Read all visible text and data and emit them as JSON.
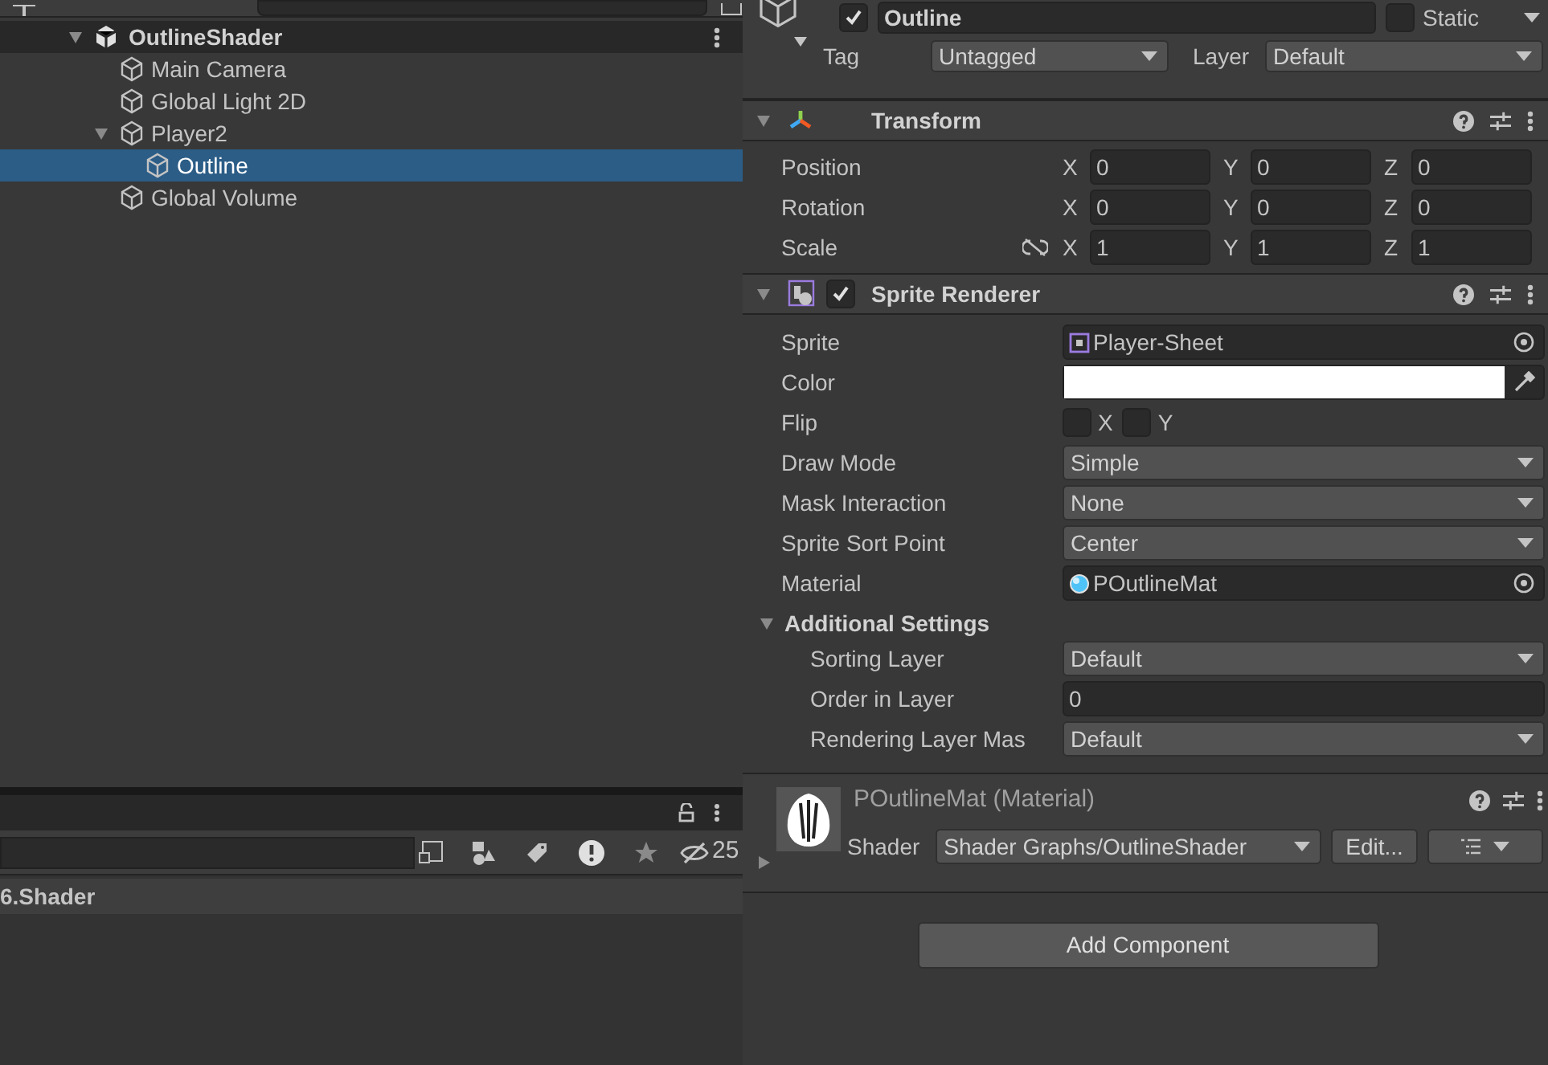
{
  "hierarchy": {
    "scene": {
      "name": "OutlineShader",
      "expanded": true
    },
    "items": [
      {
        "name": "Main Camera",
        "selected": false
      },
      {
        "name": "Global Light 2D",
        "selected": false
      },
      {
        "name": "Player2",
        "selected": false,
        "expanded": true,
        "children": [
          {
            "name": "Outline",
            "selected": true
          }
        ]
      },
      {
        "name": "Global Volume",
        "selected": false
      }
    ]
  },
  "project": {
    "hidden_count": "25",
    "rows": [
      {
        "label": "6.Shader"
      }
    ]
  },
  "inspector": {
    "object": {
      "name": "Outline",
      "active": true,
      "static_label": "Static",
      "static": false,
      "tag_label": "Tag",
      "tag": "Untagged",
      "layer_label": "Layer",
      "layer": "Default"
    },
    "transform": {
      "title": "Transform",
      "expanded": true,
      "rows": [
        {
          "label": "Position",
          "linked": false,
          "axes": [
            {
              "label": "X",
              "value": "0"
            },
            {
              "label": "Y",
              "value": "0"
            },
            {
              "label": "Z",
              "value": "0"
            }
          ]
        },
        {
          "label": "Rotation",
          "linked": false,
          "axes": [
            {
              "label": "X",
              "value": "0"
            },
            {
              "label": "Y",
              "value": "0"
            },
            {
              "label": "Z",
              "value": "0"
            }
          ]
        },
        {
          "label": "Scale",
          "linked": true,
          "axes": [
            {
              "label": "X",
              "value": "1"
            },
            {
              "label": "Y",
              "value": "1"
            },
            {
              "label": "Z",
              "value": "1"
            }
          ]
        }
      ]
    },
    "sprite_renderer": {
      "title": "Sprite Renderer",
      "enabled": true,
      "expanded": true,
      "fields": [
        {
          "kind": "sprite_ref",
          "label": "Sprite",
          "value": "Player-Sheet"
        },
        {
          "kind": "color",
          "label": "Color",
          "color": "#ffffff"
        },
        {
          "kind": "flip",
          "label": "Flip",
          "options": [
            {
              "label": "X",
              "checked": false
            },
            {
              "label": "Y",
              "checked": false
            }
          ]
        },
        {
          "kind": "dropdown",
          "label": "Draw Mode",
          "value": "Simple"
        },
        {
          "kind": "dropdown",
          "label": "Mask Interaction",
          "value": "None"
        },
        {
          "kind": "dropdown",
          "label": "Sprite Sort Point",
          "value": "Center"
        },
        {
          "kind": "material_ref",
          "label": "Material",
          "value": "POutlineMat"
        }
      ],
      "additional": {
        "title": "Additional Settings",
        "expanded": true,
        "fields": [
          {
            "kind": "dropdown",
            "label": "Sorting Layer",
            "value": "Default"
          },
          {
            "kind": "text",
            "label": "Order in Layer",
            "value": "0"
          },
          {
            "kind": "dropdown",
            "label": "Rendering Layer Mas",
            "value": "Default"
          }
        ]
      }
    },
    "material": {
      "title": "POutlineMat (Material)",
      "expanded": false,
      "shader_label": "Shader",
      "shader": "Shader Graphs/OutlineShader",
      "edit_button": "Edit..."
    },
    "add_component": "Add Component"
  }
}
